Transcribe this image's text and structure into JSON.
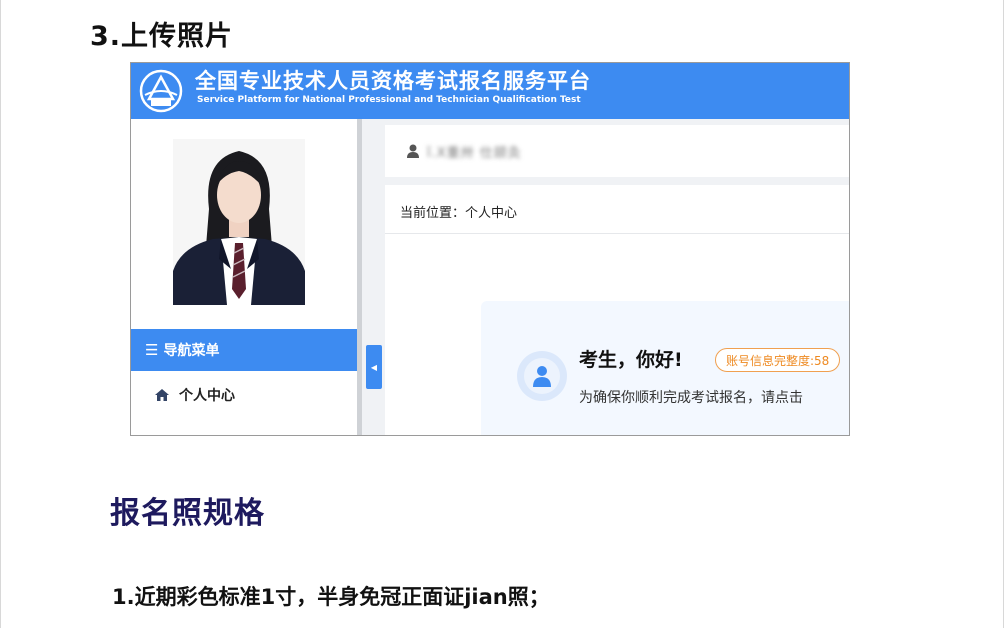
{
  "step_heading": "3.上传照片",
  "portal": {
    "title": "全国专业技术人员资格考试报名服务平台",
    "subtitle": "Service Platform for National Professional and Technician Qualification Test",
    "user_name": "ǐ.X重卅 仕颉灸",
    "breadcrumb": "当前位置：个人中心",
    "sidebar": {
      "nav_header": "导航菜单",
      "items": [
        {
          "label": "个人中心",
          "icon": "home-icon"
        }
      ]
    },
    "welcome": {
      "greeting": "考生，你好!",
      "completeness_badge": "账号信息完整度:58",
      "hint": "为确保你顺利完成考试报名，请点击"
    },
    "colors": {
      "accent": "#3d8bf1",
      "badge": "#ee8a22"
    }
  },
  "section_heading": "报名照规格",
  "rules": [
    "1.近期彩色标准1寸，半身免冠正面证jian照；"
  ]
}
